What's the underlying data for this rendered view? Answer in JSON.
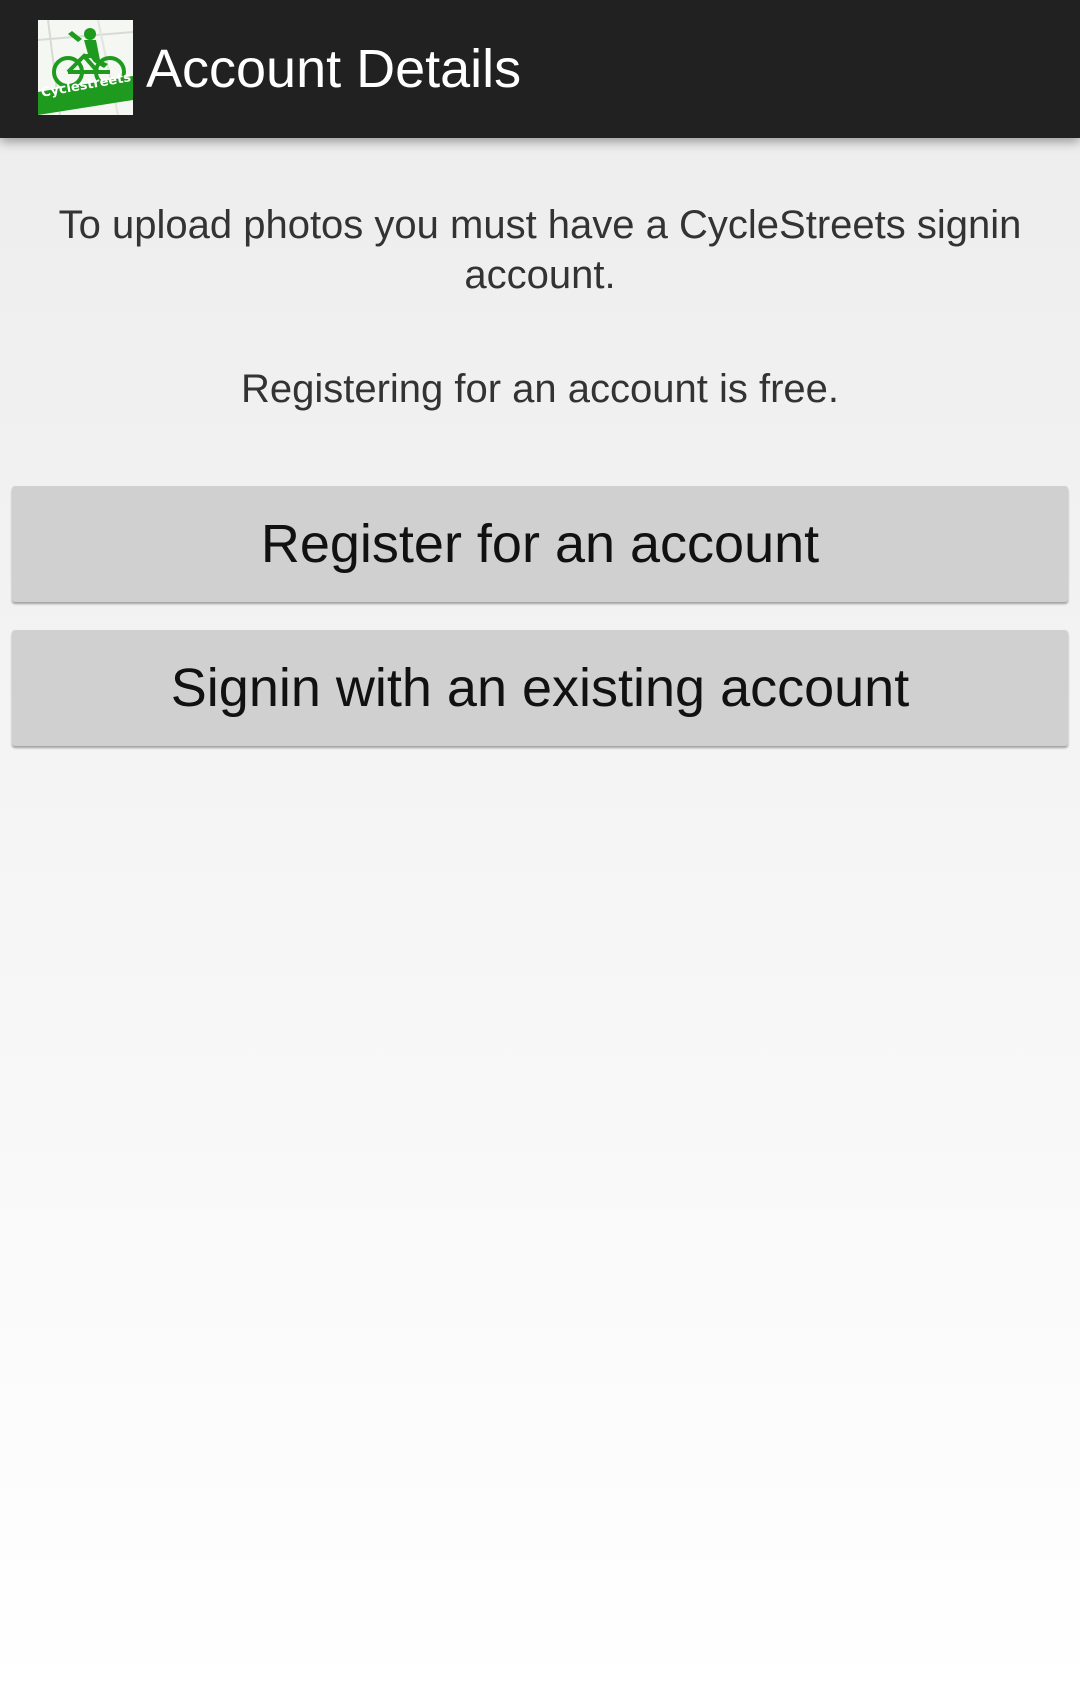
{
  "action_bar": {
    "title": "Account Details",
    "logo_text": "Cyclestreets",
    "logo_icon": "cyclestreets-logo-icon"
  },
  "content": {
    "intro_text": "To upload photos you must have a CycleStreets signin account.",
    "free_note": "Registering for an account is free."
  },
  "buttons": {
    "register_label": "Register for an account",
    "signin_label": "Signin with an existing account"
  },
  "colors": {
    "action_bar_bg": "#212121",
    "button_bg": "#d0d0d0",
    "brand_green": "#1e9a1e"
  }
}
